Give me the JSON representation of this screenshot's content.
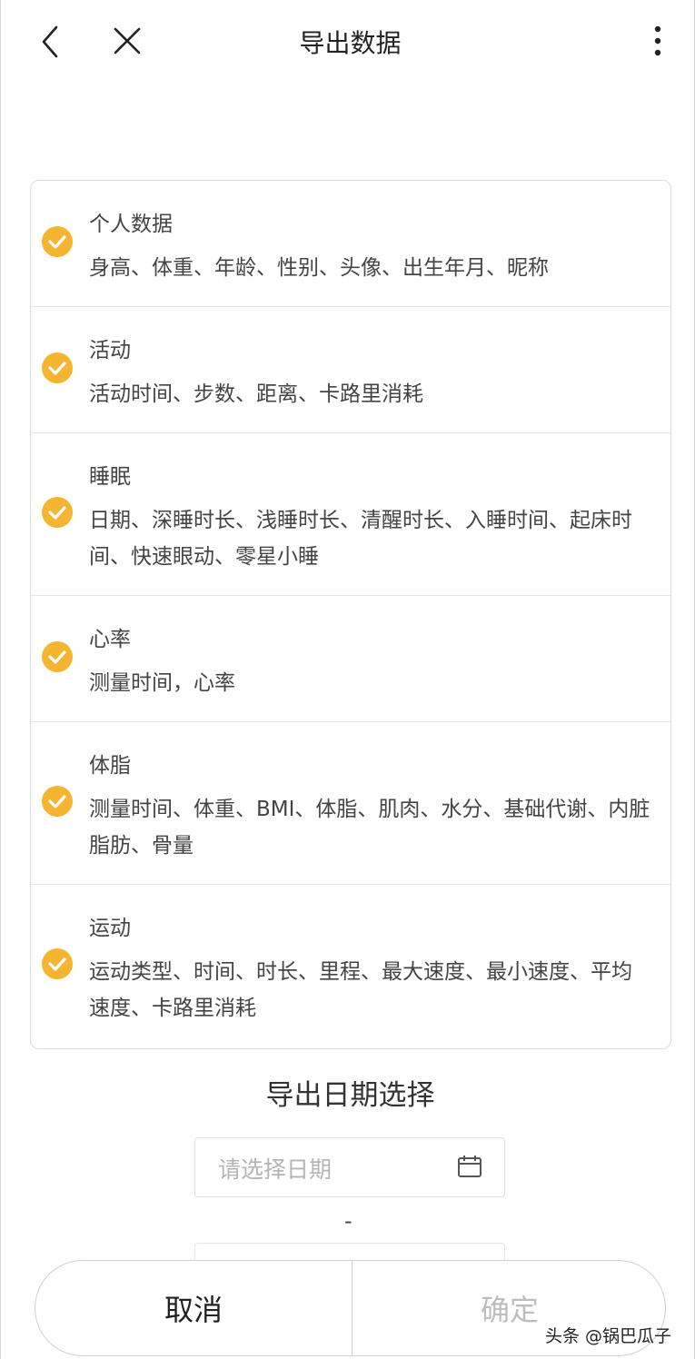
{
  "header": {
    "title": "导出数据",
    "back_icon": "chevron-left-icon",
    "close_icon": "close-icon",
    "more_icon": "more-vertical-icon"
  },
  "colors": {
    "check": "#f5b530",
    "confirm_disabled": "#bdbdbd"
  },
  "sections": [
    {
      "title": "个人数据",
      "desc": "身高、体重、年龄、性别、头像、出生年月、昵称",
      "checked": true
    },
    {
      "title": "活动",
      "desc": "活动时间、步数、距离、卡路里消耗",
      "checked": true
    },
    {
      "title": "睡眠",
      "desc": "日期、深睡时长、浅睡时长、清醒时长、入睡时间、起床时间、快速眼动、零星小睡",
      "checked": true
    },
    {
      "title": "心率",
      "desc": "测量时间，心率",
      "checked": true
    },
    {
      "title": "体脂",
      "desc": "测量时间、体重、BMI、体脂、肌肉、水分、基础代谢、内脏脂肪、骨量",
      "checked": true
    },
    {
      "title": "运动",
      "desc": "运动类型、时间、时长、里程、最大速度、最小速度、平均速度、卡路里消耗",
      "checked": true
    }
  ],
  "date_selection": {
    "title": "导出日期选择",
    "start_placeholder": "请选择日期",
    "separator": "-"
  },
  "bottom": {
    "cancel_label": "取消",
    "confirm_label": "确定"
  },
  "watermark": "头条 @锅巴瓜子"
}
